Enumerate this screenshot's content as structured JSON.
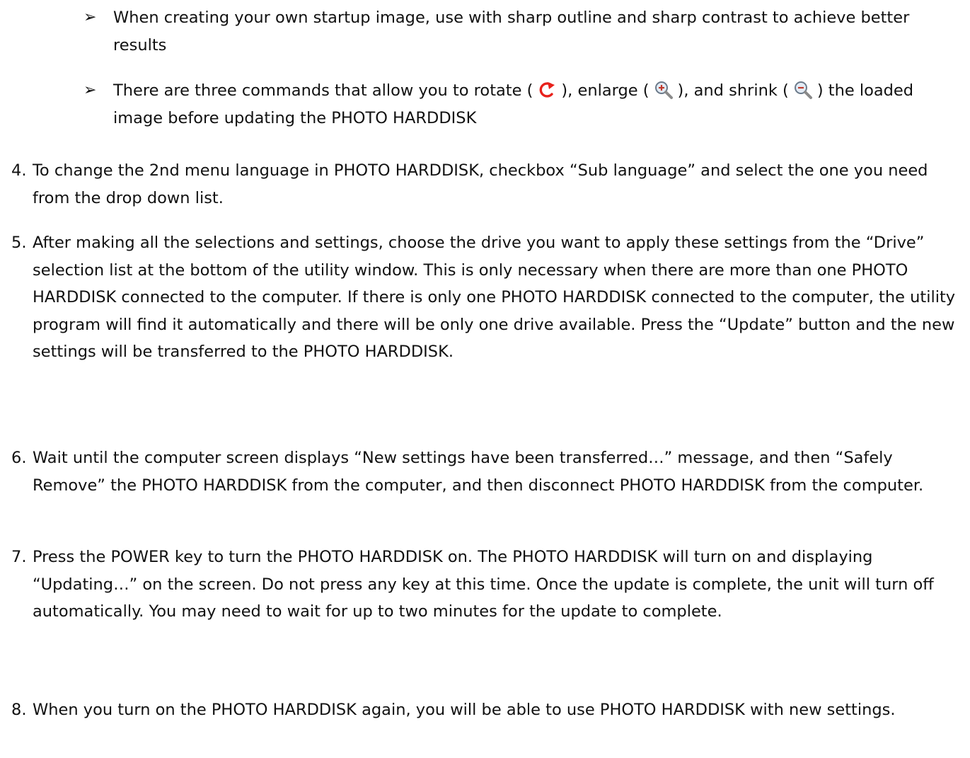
{
  "bullets": [
    {
      "marker": "➢",
      "text": "When creating your own startup image, use with sharp outline and sharp contrast to achieve better results"
    },
    {
      "marker": "➢",
      "part1": "There are three commands that allow you to rotate (",
      "part2": "), enlarge (",
      "part3": "), and shrink (",
      "part4": ") the loaded image before updating the PHOTO HARDDISK",
      "icons": [
        "rotate-icon",
        "zoom-in-icon",
        "zoom-out-icon"
      ]
    }
  ],
  "steps": [
    {
      "number": "4.",
      "text": "To change the 2nd menu language in PHOTO HARDDISK, checkbox “Sub language” and select the one you need from the drop down list."
    },
    {
      "number": "5.",
      "text": "After making all the selections and settings, choose the drive you want to apply these settings from the “Drive” selection list at the bottom of the utility window. This is only necessary when there are more than one PHOTO HARDDISK connected to the computer.   If there is only one PHOTO HARDDISK connected to the computer, the utility program will find it automatically and there will be only one drive available. Press the “Update” button and the new settings will be transferred to the PHOTO HARDDISK."
    },
    {
      "number": "6.",
      "text": "Wait until the computer screen displays “New settings have been transferred…” message, and then “Safely Remove” the PHOTO HARDDISK from the computer, and then disconnect PHOTO HARDDISK from the computer."
    },
    {
      "number": "7.",
      "text": "Press the POWER key to turn the PHOTO HARDDISK on.   The PHOTO HARDDISK will turn on and displaying “Updating…” on the screen.   Do not press any key at this time. Once the update is complete, the unit will turn off automatically. You may need to wait for up to two minutes for the update to complete."
    },
    {
      "number": "8.",
      "text": "When you turn on the PHOTO HARDDISK again, you will be able to use PHOTO HARDDISK with new settings."
    }
  ],
  "colors": {
    "text": "#111111",
    "rotate_icon": "#e8211b",
    "magnifier_lens": "#e3ecf6",
    "magnifier_handle": "#8a8a8a"
  }
}
